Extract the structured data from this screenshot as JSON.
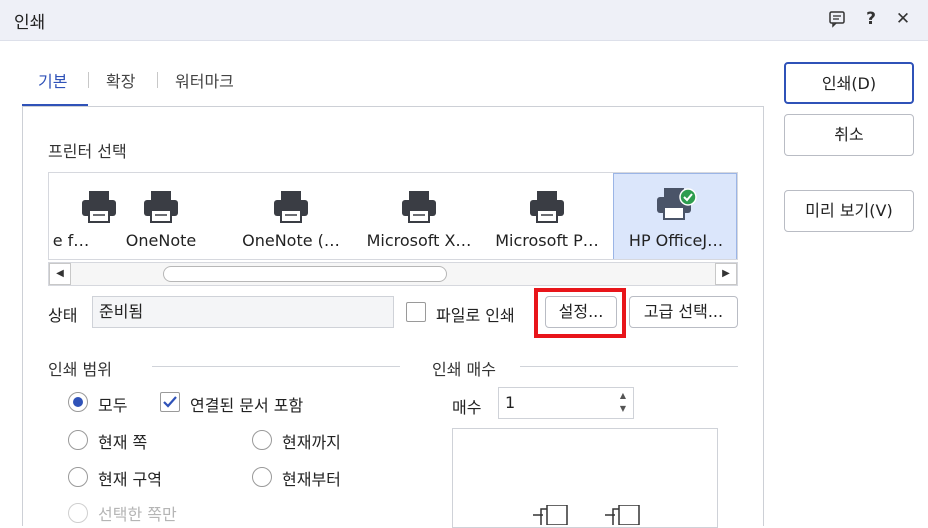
{
  "window": {
    "title": "인쇄"
  },
  "titlebar_icons": [
    "chat-icon",
    "help-icon",
    "close-icon"
  ],
  "titlebar_glyphs": {
    "help": "?",
    "close": "✕"
  },
  "tabs": [
    {
      "label": "기본",
      "active": true
    },
    {
      "label": "확장",
      "active": false
    },
    {
      "label": "워터마크",
      "active": false
    }
  ],
  "printer_select": {
    "label": "프린터 선택",
    "printers": [
      {
        "name": "e f…",
        "selected": false
      },
      {
        "name": "OneNote",
        "selected": false
      },
      {
        "name": "OneNote (…",
        "selected": false
      },
      {
        "name": "Microsoft X…",
        "selected": false
      },
      {
        "name": "Microsoft P…",
        "selected": false
      },
      {
        "name": "HP OfficeJ…",
        "selected": true
      }
    ]
  },
  "status": {
    "label": "상태",
    "value": "준비됨"
  },
  "print_to_file": {
    "label": "파일로 인쇄",
    "checked": false
  },
  "buttons": {
    "settings": "설정...",
    "advanced": "고급 선택...",
    "print": "인쇄(D)",
    "cancel": "취소",
    "preview": "미리 보기(V)"
  },
  "print_range": {
    "title": "인쇄 범위",
    "options": [
      {
        "label": "모두",
        "checked": true
      },
      {
        "label": "현재 쪽",
        "checked": false
      },
      {
        "label": "현재까지",
        "checked": false
      },
      {
        "label": "현재 구역",
        "checked": false
      },
      {
        "label": "현재부터",
        "checked": false
      },
      {
        "label": "선택한 쪽만",
        "checked": false,
        "disabled": true
      }
    ],
    "include_linked": {
      "label": "연결된 문서 포함",
      "checked": true
    }
  },
  "copies": {
    "title": "인쇄 매수",
    "label": "매수",
    "value": "1"
  },
  "colors": {
    "accent": "#2f52b8",
    "highlight": "#e8151a",
    "selected_bg": "#dbe6fb"
  }
}
